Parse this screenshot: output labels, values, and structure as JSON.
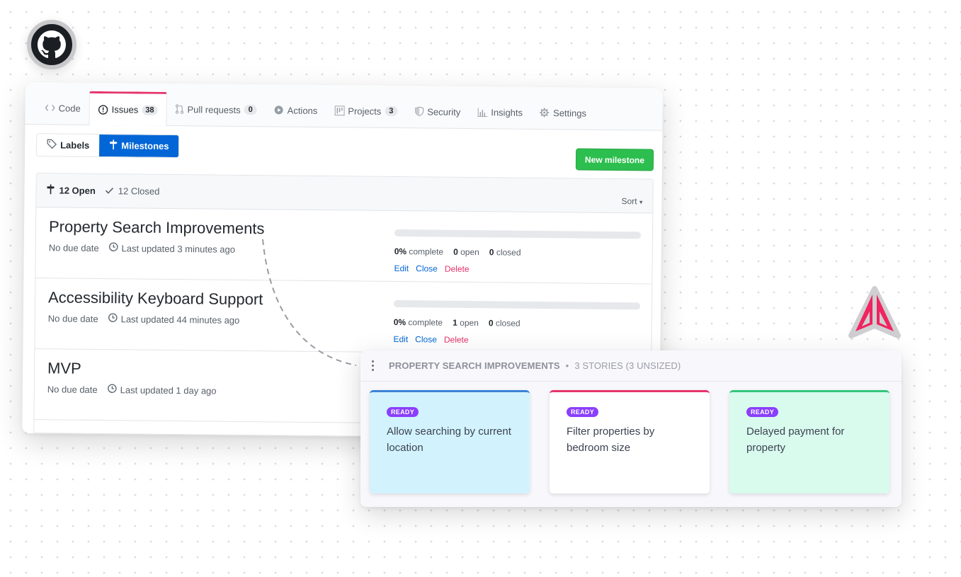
{
  "logos": {
    "left": "github-logo",
    "right": "brand-logo"
  },
  "tabs": [
    {
      "label": "Code",
      "icon": "code-icon",
      "counter": null,
      "selected": false
    },
    {
      "label": "Issues",
      "icon": "issue-opened-icon",
      "counter": "38",
      "selected": true
    },
    {
      "label": "Pull requests",
      "icon": "pull-request-icon",
      "counter": "0",
      "selected": false
    },
    {
      "label": "Actions",
      "icon": "play-icon",
      "counter": null,
      "selected": false
    },
    {
      "label": "Projects",
      "icon": "project-icon",
      "counter": "3",
      "selected": false
    },
    {
      "label": "Security",
      "icon": "shield-icon",
      "counter": null,
      "selected": false
    },
    {
      "label": "Insights",
      "icon": "graph-icon",
      "counter": null,
      "selected": false
    },
    {
      "label": "Settings",
      "icon": "gear-icon",
      "counter": null,
      "selected": false
    }
  ],
  "subnav": {
    "labels": "Labels",
    "milestones": "Milestones",
    "new_milestone": "New milestone"
  },
  "filter": {
    "open": "12 Open",
    "closed": "12 Closed",
    "sort": "Sort"
  },
  "milestones": [
    {
      "title": "Property Search Improvements",
      "due": "No due date",
      "updated": "Last updated 3 minutes ago",
      "percent": "0%",
      "percent_value": 0,
      "complete_label": "complete",
      "open": "0",
      "open_label": "open",
      "closed": "0",
      "closed_label": "closed",
      "edit": "Edit",
      "close": "Close",
      "delete": "Delete"
    },
    {
      "title": "Accessibility Keyboard Support",
      "due": "No due date",
      "updated": "Last updated 44 minutes ago",
      "percent": "0%",
      "percent_value": 0,
      "complete_label": "complete",
      "open": "1",
      "open_label": "open",
      "closed": "0",
      "closed_label": "closed",
      "edit": "Edit",
      "close": "Close",
      "delete": "Delete"
    },
    {
      "title": "MVP",
      "due": "No due date",
      "updated": "Last updated 1 day ago"
    }
  ],
  "panel": {
    "title": "PROPERTY SEARCH IMPROVEMENTS",
    "separator": "•",
    "summary": "3 STORIES (3 UNSIZED)",
    "cards": [
      {
        "badge": "READY",
        "title": "Allow searching by current location",
        "bg": "#d2f3fd",
        "accent": "#3b82d6"
      },
      {
        "badge": "READY",
        "title": "Filter properties by bedroom size",
        "bg": "#ffffff",
        "accent": "#e6336b"
      },
      {
        "badge": "READY",
        "title": "Delayed payment for property",
        "bg": "#d8fbee",
        "accent": "#34c77b"
      }
    ]
  },
  "colors": {
    "accent_pink": "#e6336b",
    "github_blue": "#0366d6",
    "github_green": "#2cbe4e",
    "badge_purple": "#8a3ffc"
  }
}
